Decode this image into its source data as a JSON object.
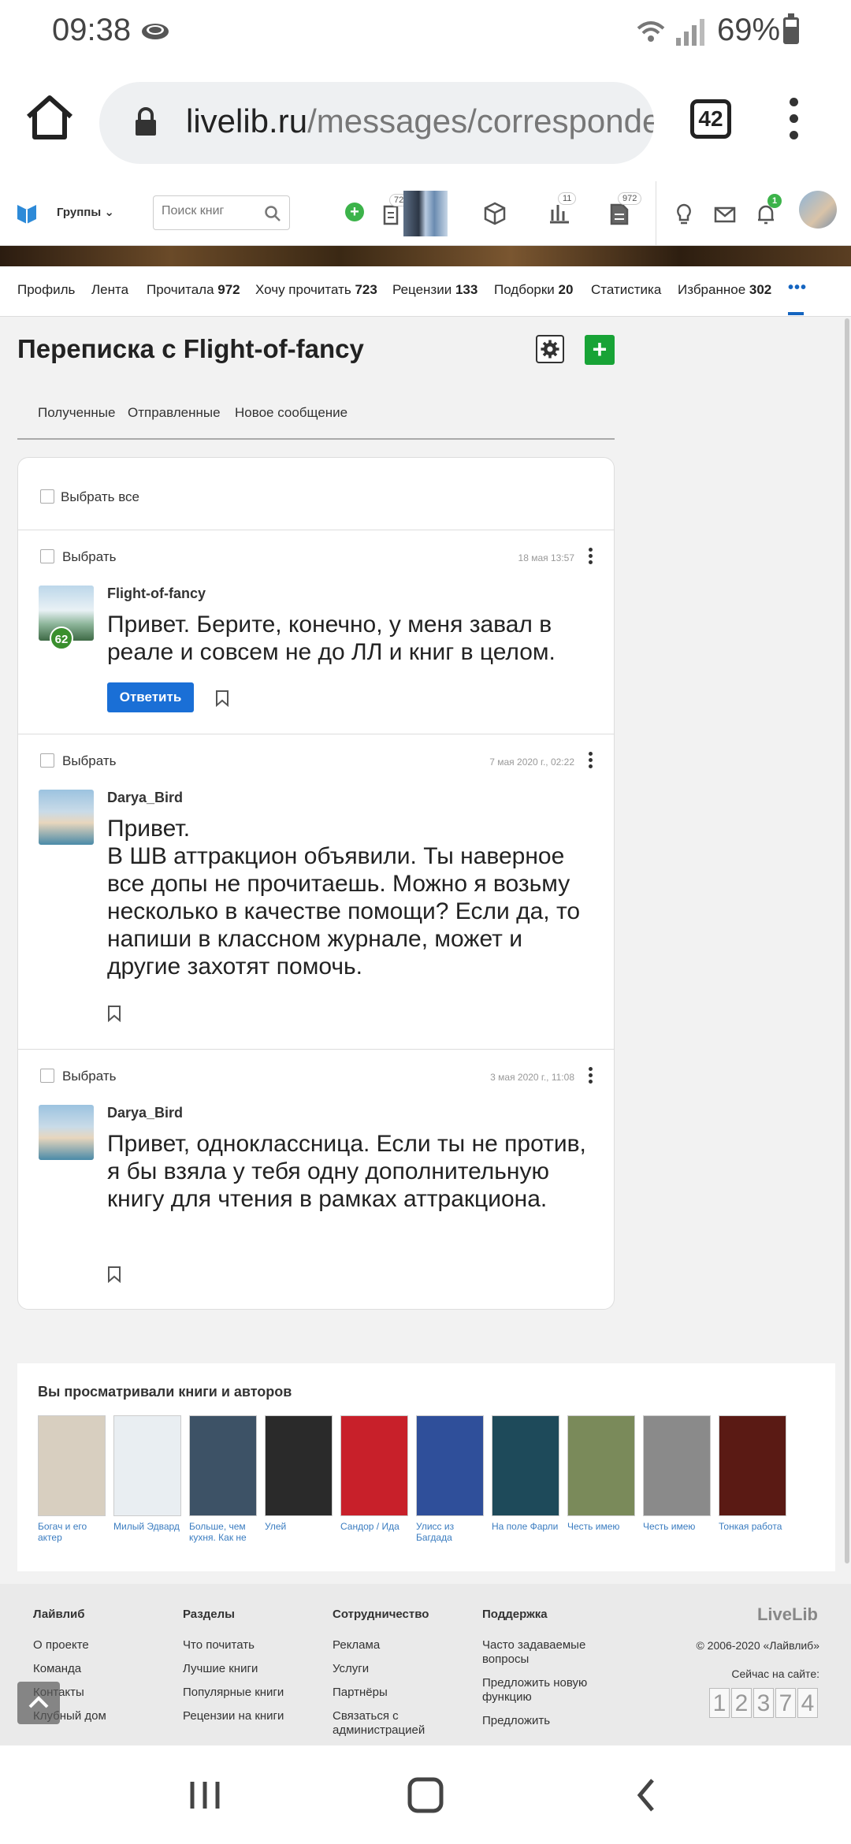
{
  "status_bar": {
    "time": "09:38",
    "battery": "69%"
  },
  "browser": {
    "url_domain": "livelib.ru",
    "url_path": "/messages/corresponden",
    "tab_count": "42"
  },
  "header": {
    "groups_label": "Группы",
    "search_placeholder": "Поиск книг",
    "badges": {
      "want_to_read": "723",
      "stats": "11",
      "read": "972",
      "notifications": "1"
    }
  },
  "profile_tabs": [
    {
      "label": "Профиль",
      "count": ""
    },
    {
      "label": "Лента",
      "count": ""
    },
    {
      "label": "Прочитала",
      "count": "972"
    },
    {
      "label": "Хочу прочитать",
      "count": "723"
    },
    {
      "label": "Рецензии",
      "count": "133"
    },
    {
      "label": "Подборки",
      "count": "20"
    },
    {
      "label": "Статистика",
      "count": ""
    },
    {
      "label": "Избранное",
      "count": "302"
    }
  ],
  "page": {
    "title": "Переписка с Flight-of-fancy",
    "subtabs": [
      "Полученные",
      "Отправленные",
      "Новое сообщение"
    ],
    "select_all": "Выбрать все"
  },
  "messages": [
    {
      "select": "Выбрать",
      "date": "18 мая 13:57",
      "user": "Flight-of-fancy",
      "level": "62",
      "text": "Привет. Берите, конечно, у меня завал в реале и совсем не до ЛЛ и книг в целом.",
      "reply": "Ответить"
    },
    {
      "select": "Выбрать",
      "date": "7 мая 2020 г., 02:22",
      "user": "Darya_Bird",
      "text": "Привет.\nВ ШВ аттракцион объявили. Ты наверное все допы не прочитаешь. Можно я возьму несколько в качестве помощи? Если да, то напиши в классном журнале, может и другие захотят помочь."
    },
    {
      "select": "Выбрать",
      "date": "3 мая 2020 г., 11:08",
      "user": "Darya_Bird",
      "text": "Привет, одноклассница. Если ты не против, я бы взяла у тебя одну дополнительную книгу для чтения в рамках аттракциона."
    }
  ],
  "viewed": {
    "heading": "Вы просматривали книги и авторов",
    "books": [
      {
        "title": "Богач и его актер",
        "color": "#d8cfc0"
      },
      {
        "title": "Милый Эдвард",
        "color": "#e9eef2"
      },
      {
        "title": "Больше, чем кухня. Как не",
        "color": "#3d5266"
      },
      {
        "title": "Улей",
        "color": "#2a2a2a"
      },
      {
        "title": "Сандор / Ида",
        "color": "#c8202a"
      },
      {
        "title": "Улисс из Багдада",
        "color": "#2f4f9a"
      },
      {
        "title": "На поле Фарли",
        "color": "#1e4a5a"
      },
      {
        "title": "Честь имею",
        "color": "#7a8a5a"
      },
      {
        "title": "Честь имею",
        "color": "#8a8a8a"
      },
      {
        "title": "Тонкая работа",
        "color": "#5a1a14"
      }
    ]
  },
  "footer": {
    "columns": [
      {
        "heading": "Лайвлиб",
        "items": [
          "О проекте",
          "Команда",
          "Контакты",
          "Клубный дом"
        ]
      },
      {
        "heading": "Разделы",
        "items": [
          "Что почитать",
          "Лучшие книги",
          "Популярные книги",
          "Рецензии на книги"
        ]
      },
      {
        "heading": "Сотрудничество",
        "items": [
          "Реклама",
          "Услуги",
          "Партнёры",
          "Связаться с администрацией"
        ]
      },
      {
        "heading": "Поддержка",
        "items": [
          "Часто задаваемые вопросы",
          "Предложить новую функцию",
          "Предложить"
        ]
      }
    ],
    "brand": "LiveLib",
    "copyright": "© 2006-2020 «Лайвлиб»",
    "online_label": "Сейчас на сайте:",
    "online_digits": [
      "1",
      "2",
      "3",
      "7",
      "4"
    ]
  }
}
